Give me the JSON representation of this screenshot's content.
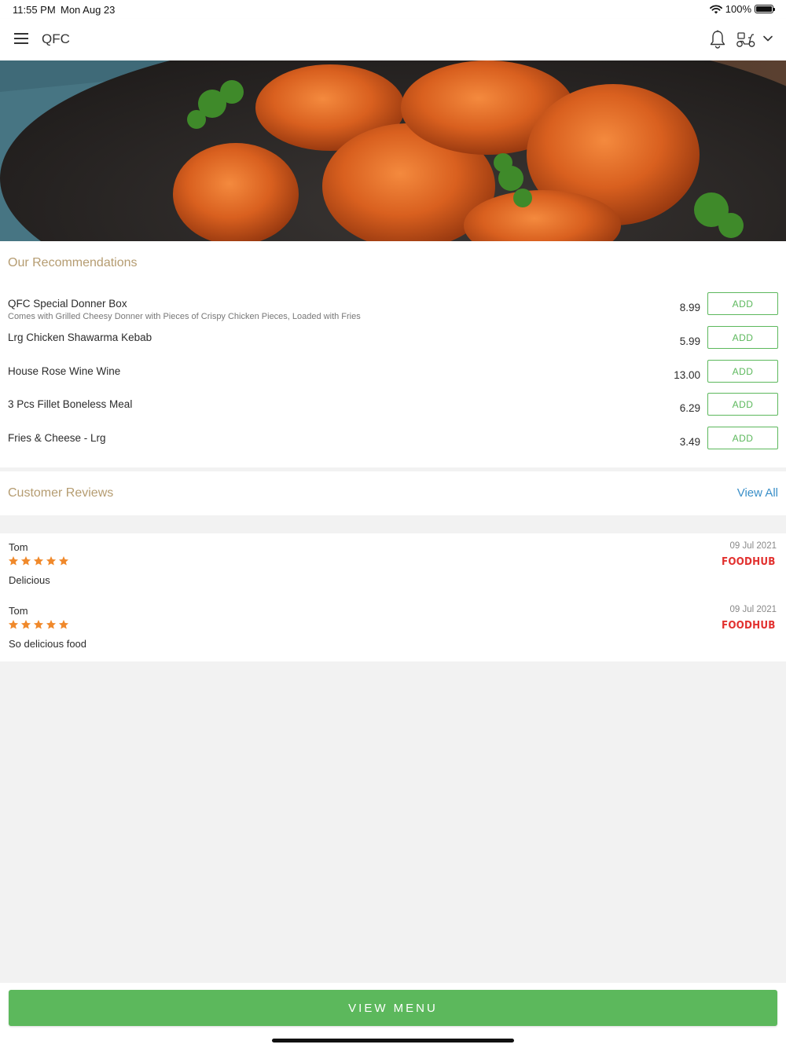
{
  "status_bar": {
    "time": "11:55 PM",
    "date": "Mon Aug 23",
    "battery": "100%",
    "battery_level": 1.0
  },
  "header": {
    "title": "QFC",
    "icons": [
      "menu-icon",
      "bell-icon",
      "scooter-icon",
      "chevron-down-icon"
    ]
  },
  "hero": {
    "image": "fried-chicken-photo"
  },
  "recommendations": {
    "title": "Our Recommendations",
    "items": [
      {
        "name": "QFC Special Donner Box",
        "description": "Comes with Grilled Cheesy Donner with Pieces of Crispy Chicken Pieces, Loaded with Fries",
        "price": "8.99",
        "button": "ADD"
      },
      {
        "name": "Lrg Chicken Shawarma Kebab",
        "description": "",
        "price": "5.99",
        "button": "ADD"
      },
      {
        "name": "House Rose Wine Wine",
        "description": "",
        "price": "13.00",
        "button": "ADD"
      },
      {
        "name": "3 Pcs Fillet Boneless Meal",
        "description": "",
        "price": "6.29",
        "button": "ADD"
      },
      {
        "name": "Fries & Cheese - Lrg",
        "description": "",
        "price": "3.49",
        "button": "ADD"
      }
    ]
  },
  "reviews": {
    "title": "Customer Reviews",
    "view_all": "View All",
    "items": [
      {
        "name": "Tom",
        "rating": 5,
        "text": "Delicious",
        "date": "09 Jul 2021",
        "source": "FOODHUB"
      },
      {
        "name": "Tom",
        "rating": 5,
        "text": "So delicious food",
        "date": "09 Jul 2021",
        "source": "FOODHUB"
      }
    ]
  },
  "bottom": {
    "view_menu": "VIEW MENU"
  },
  "colors": {
    "accent_green": "#5cb85c",
    "section_title": "#b59c71",
    "link_blue": "#3a8fc8",
    "star_orange": "#f0892b",
    "foodhub_red": "#e2312f"
  }
}
